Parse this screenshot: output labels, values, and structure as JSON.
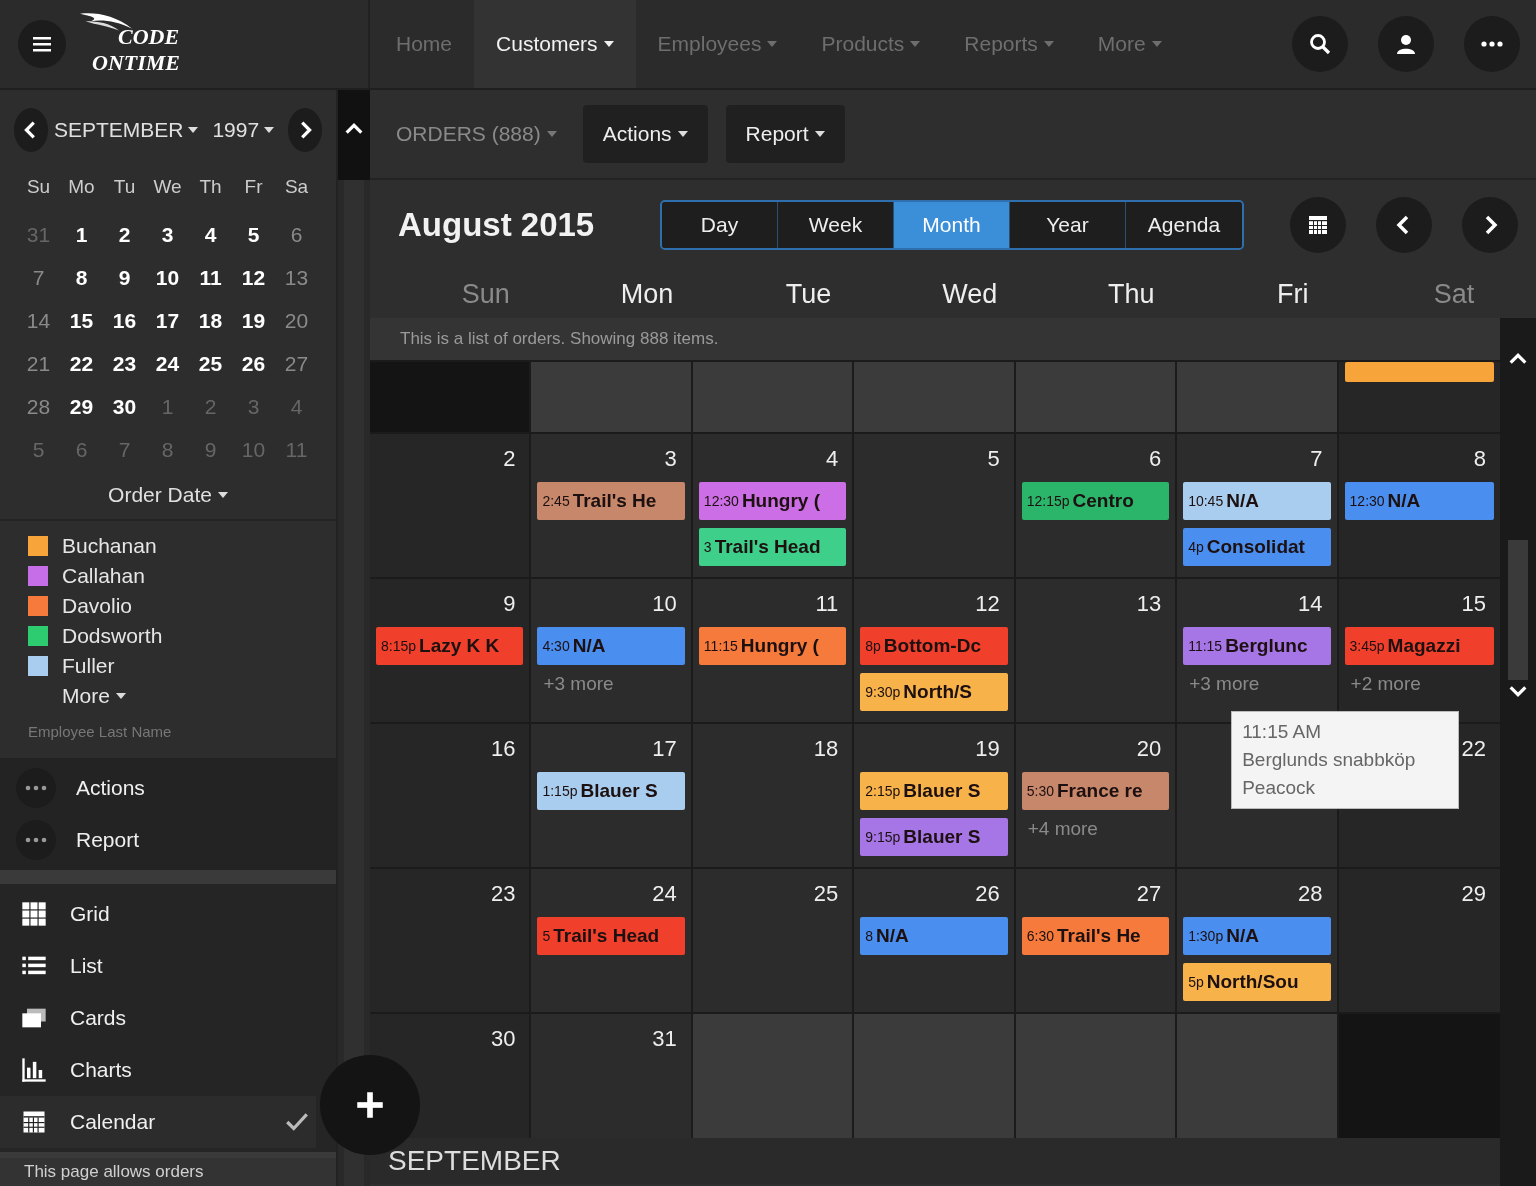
{
  "brand": {
    "line_1": "CODE",
    "line_2": "ONTIME"
  },
  "nav": [
    {
      "label": "Home",
      "selected": false,
      "has_menu": false
    },
    {
      "label": "Customers",
      "selected": true,
      "has_menu": true
    },
    {
      "label": "Employees",
      "selected": false,
      "has_menu": true
    },
    {
      "label": "Products",
      "selected": false,
      "has_menu": true
    },
    {
      "label": "Reports",
      "selected": false,
      "has_menu": true
    },
    {
      "label": "More",
      "selected": false,
      "has_menu": true
    }
  ],
  "mini_calendar": {
    "month": "SEPTEMBER",
    "year": "1997",
    "weekdays": [
      "Su",
      "Mo",
      "Tu",
      "We",
      "Th",
      "Fr",
      "Sa"
    ],
    "weeks": [
      [
        {
          "day": "31",
          "other_month": true
        },
        {
          "day": "1",
          "other_month": false
        },
        {
          "day": "2",
          "other_month": false
        },
        {
          "day": "3",
          "other_month": false
        },
        {
          "day": "4",
          "other_month": false
        },
        {
          "day": "5",
          "other_month": false
        },
        {
          "day": "6",
          "other_month": false
        }
      ],
      [
        {
          "day": "7",
          "other_month": false
        },
        {
          "day": "8",
          "other_month": false
        },
        {
          "day": "9",
          "other_month": false
        },
        {
          "day": "10",
          "other_month": false
        },
        {
          "day": "11",
          "other_month": false
        },
        {
          "day": "12",
          "other_month": false
        },
        {
          "day": "13",
          "other_month": false
        }
      ],
      [
        {
          "day": "14",
          "other_month": false
        },
        {
          "day": "15",
          "other_month": false
        },
        {
          "day": "16",
          "other_month": false
        },
        {
          "day": "17",
          "other_month": false
        },
        {
          "day": "18",
          "other_month": false
        },
        {
          "day": "19",
          "other_month": false
        },
        {
          "day": "20",
          "other_month": false
        }
      ],
      [
        {
          "day": "21",
          "other_month": false
        },
        {
          "day": "22",
          "other_month": false
        },
        {
          "day": "23",
          "other_month": false
        },
        {
          "day": "24",
          "other_month": false
        },
        {
          "day": "25",
          "other_month": false
        },
        {
          "day": "26",
          "other_month": false
        },
        {
          "day": "27",
          "other_month": false
        }
      ],
      [
        {
          "day": "28",
          "other_month": false
        },
        {
          "day": "29",
          "other_month": false
        },
        {
          "day": "30",
          "other_month": false
        },
        {
          "day": "1",
          "other_month": true
        },
        {
          "day": "2",
          "other_month": true
        },
        {
          "day": "3",
          "other_month": true
        },
        {
          "day": "4",
          "other_month": true
        }
      ],
      [
        {
          "day": "5",
          "other_month": true
        },
        {
          "day": "6",
          "other_month": true
        },
        {
          "day": "7",
          "other_month": true
        },
        {
          "day": "8",
          "other_month": true
        },
        {
          "day": "9",
          "other_month": true
        },
        {
          "day": "10",
          "other_month": true
        },
        {
          "day": "11",
          "other_month": true
        }
      ]
    ],
    "date_field": "Order Date"
  },
  "legend": {
    "items": [
      {
        "label": "Buchanan",
        "color": "#f7a53b"
      },
      {
        "label": "Callahan",
        "color": "#c56ee8"
      },
      {
        "label": "Davolio",
        "color": "#f57a3c"
      },
      {
        "label": "Dodsworth",
        "color": "#2ecc71"
      },
      {
        "label": "Fuller",
        "color": "#a9cdee"
      }
    ],
    "more": "More",
    "caption": "Employee Last Name"
  },
  "side_actions": [
    {
      "label": "Actions"
    },
    {
      "label": "Report"
    }
  ],
  "views": [
    {
      "label": "Grid",
      "kind": "grid",
      "selected": false
    },
    {
      "label": "List",
      "kind": "list",
      "selected": false
    },
    {
      "label": "Cards",
      "kind": "cards",
      "selected": false
    },
    {
      "label": "Charts",
      "kind": "charts",
      "selected": false
    },
    {
      "label": "Calendar",
      "kind": "calendar",
      "selected": true
    }
  ],
  "description": "This page allows orders",
  "toolbar": {
    "title": "ORDERS (888)",
    "buttons": [
      "Actions",
      "Report"
    ]
  },
  "calendar": {
    "title": "August 2015",
    "views": [
      {
        "label": "Day",
        "selected": false
      },
      {
        "label": "Week",
        "selected": false
      },
      {
        "label": "Month",
        "selected": true
      },
      {
        "label": "Year",
        "selected": false
      },
      {
        "label": "Agenda",
        "selected": false
      }
    ],
    "weekdays": [
      "Sun",
      "Mon",
      "Tue",
      "Wed",
      "Thu",
      "Fri",
      "Sat"
    ],
    "info": "This is a list of orders. Showing 888 items.",
    "weeks": [
      {
        "partial": true,
        "days": [
          {
            "other_month": true
          },
          {
            "other_month": true
          },
          {
            "other_month": true
          },
          {
            "other_month": true
          },
          {
            "other_month": true
          },
          {
            "other_month": true
          },
          {
            "events": [
              {
                "color": "#f7a53b"
              }
            ]
          }
        ]
      },
      {
        "partial": false,
        "days": [
          {
            "day": "2"
          },
          {
            "day": "3",
            "other_month": false,
            "events": [
              {
                "time": "2:45",
                "title": "Trail's He",
                "color": "#c7876a"
              }
            ]
          },
          {
            "day": "4",
            "other_month": false,
            "events": [
              {
                "time": "12:30",
                "title": "Hungry (",
                "color": "#cc6ee6"
              },
              {
                "time": "3",
                "title": "Trail's Head",
                "color": "#3ed08a"
              }
            ]
          },
          {
            "day": "5",
            "other_month": false
          },
          {
            "day": "6",
            "other_month": false,
            "events": [
              {
                "time": "12:15p",
                "title": "Centro",
                "color": "#2bb56b"
              }
            ]
          },
          {
            "day": "7",
            "other_month": false,
            "events": [
              {
                "time": "10:45",
                "title": "N/A",
                "color": "#a9cdee"
              },
              {
                "time": "4p",
                "title": "Consolidat",
                "color": "#4a8ef0"
              }
            ]
          },
          {
            "day": "8",
            "events": [
              {
                "time": "12:30",
                "title": "N/A",
                "color": "#4a8ef0"
              }
            ]
          }
        ]
      },
      {
        "partial": false,
        "days": [
          {
            "day": "9",
            "events": [
              {
                "time": "8:15p",
                "title": "Lazy K K",
                "color": "#f0402c"
              }
            ]
          },
          {
            "day": "10",
            "other_month": false,
            "events": [
              {
                "time": "4:30",
                "title": "N/A",
                "color": "#4a8ef0"
              }
            ],
            "more": "+3 more"
          },
          {
            "day": "11",
            "other_month": false,
            "events": [
              {
                "time": "11:15",
                "title": "Hungry (",
                "color": "#f57a3c"
              }
            ]
          },
          {
            "day": "12",
            "other_month": false,
            "events": [
              {
                "time": "8p",
                "title": "Bottom-Dc",
                "color": "#f0402c"
              },
              {
                "time": "9:30p",
                "title": "North/S",
                "color": "#f8b24a"
              }
            ]
          },
          {
            "day": "13",
            "other_month": false
          },
          {
            "day": "14",
            "other_month": false,
            "events": [
              {
                "time": "11:15",
                "title": "Berglunc",
                "color": "#a675e6",
                "tooltip": [
                  "11:15 AM",
                  "Berglunds snabbköp",
                  "Peacock"
                ]
              }
            ],
            "more": "+3 more"
          },
          {
            "day": "15",
            "events": [
              {
                "time": "3:45p",
                "title": "Magazzi",
                "color": "#f0402c"
              }
            ],
            "more": "+2 more"
          }
        ]
      },
      {
        "partial": false,
        "days": [
          {
            "day": "16"
          },
          {
            "day": "17",
            "other_month": false,
            "events": [
              {
                "time": "1:15p",
                "title": "Blauer S",
                "color": "#a9cdee"
              }
            ]
          },
          {
            "day": "18",
            "other_month": false
          },
          {
            "day": "19",
            "other_month": false,
            "events": [
              {
                "time": "2:15p",
                "title": "Blauer S",
                "color": "#f8b24a"
              },
              {
                "time": "9:15p",
                "title": "Blauer S",
                "color": "#a675e6"
              }
            ]
          },
          {
            "day": "20",
            "other_month": false,
            "events": [
              {
                "time": "5:30",
                "title": "France re",
                "color": "#c7876a"
              }
            ],
            "more": "+4 more"
          },
          {
            "other_month": false
          },
          {
            "day": "22"
          }
        ]
      },
      {
        "partial": false,
        "days": [
          {
            "day": "23"
          },
          {
            "day": "24",
            "other_month": false,
            "events": [
              {
                "time": "5",
                "title": "Trail's Head",
                "color": "#f0402c"
              }
            ]
          },
          {
            "day": "25",
            "other_month": false
          },
          {
            "day": "26",
            "other_month": false,
            "events": [
              {
                "time": "8",
                "title": "N/A",
                "color": "#4a8ef0"
              }
            ]
          },
          {
            "day": "27",
            "other_month": false,
            "events": [
              {
                "time": "6:30",
                "title": "Trail's He",
                "color": "#f57a3c"
              }
            ]
          },
          {
            "day": "28",
            "other_month": false,
            "events": [
              {
                "time": "1:30p",
                "title": "N/A",
                "color": "#4a8ef0"
              },
              {
                "time": "5p",
                "title": "North/Sou",
                "color": "#f8b24a"
              }
            ]
          },
          {
            "day": "29"
          }
        ]
      },
      {
        "partial": false,
        "days": [
          {
            "day": "30"
          },
          {
            "day": "31",
            "other_month": false
          },
          {
            "other_month": true
          },
          {
            "other_month": true
          },
          {
            "other_month": true
          },
          {
            "other_month": true
          },
          {
            "other_month": true
          }
        ]
      }
    ],
    "next_month": "SEPTEMBER"
  }
}
